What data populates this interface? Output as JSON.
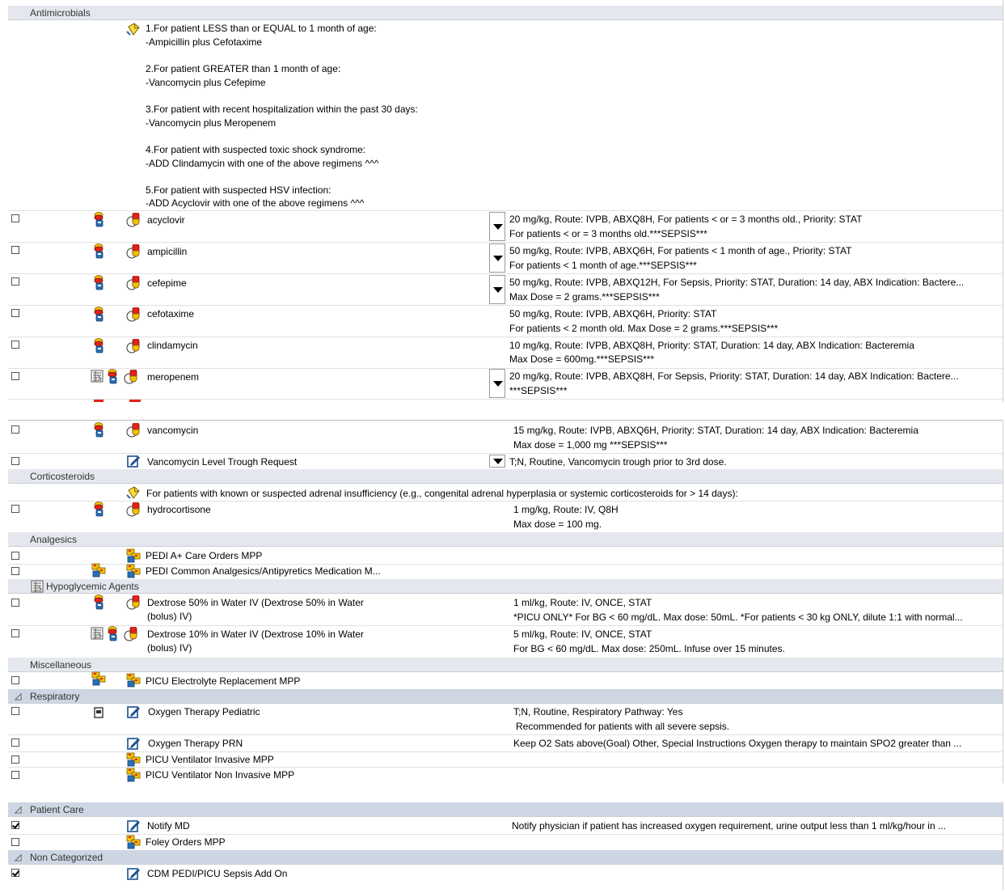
{
  "sections": {
    "antimicrobials": "Antimicrobials",
    "corticosteroids": "Corticosteroids",
    "analgesics": "Analgesics",
    "hypoglycemic": "Hypoglycemic Agents",
    "miscellaneous": "Miscellaneous",
    "respiratory": "Respiratory",
    "patient_care": "Patient Care",
    "non_categorized": "Non Categorized"
  },
  "antimicrobial_note": [
    "1.For patient LESS than or EQUAL to 1 month of age:",
    "-Ampicillin plus Cefotaxime",
    "2.For patient GREATER than 1 month of age:",
    "-Vancomycin plus Cefepime",
    "3.For patient with recent hospitalization within the past 30 days:",
    "-Vancomycin plus Meropenem",
    "4.For patient with suspected toxic shock syndrome:",
    "-ADD Clindamycin with one of the above regimens ^^^",
    "5.For patient with suspected HSV infection:",
    "-ADD Acyclovir with one of the above regimens ^^^"
  ],
  "meds": [
    {
      "name": "acyclovir",
      "d1": "20 mg/kg, Route: IVPB, ABXQ8H, For patients < or = 3 months old., Priority: STAT",
      "d2": "For patients <  or = 3 months old.***SEPSIS***"
    },
    {
      "name": "ampicillin",
      "d1": "50 mg/kg, Route: IVPB, ABXQ6H, For patients < 1 month of age., Priority: STAT",
      "d2": "For patients < 1 month of age.***SEPSIS***"
    },
    {
      "name": "cefepime",
      "d1": "50 mg/kg, Route: IVPB, ABXQ12H, For Sepsis, Priority: STAT, Duration: 14 day, ABX Indication: Bactere...",
      "d2": "Max Dose = 2 grams.***SEPSIS***"
    },
    {
      "name": "cefotaxime",
      "d1": "50 mg/kg, Route: IVPB, ABXQ6H, Priority: STAT",
      "d2": "For patients < 2 month old.  Max Dose = 2 grams.***SEPSIS***"
    },
    {
      "name": "clindamycin",
      "d1": "10 mg/kg, Route: IVPB, ABXQ8H, Priority: STAT, Duration: 14 day, ABX Indication: Bacteremia",
      "d2": "Max Dose = 600mg.***SEPSIS***"
    },
    {
      "name": "meropenem",
      "d1": "20 mg/kg, Route: IVPB, ABXQ8H, For Sepsis, Priority: STAT, Duration: 14 day, ABX Indication: Bactere...",
      "d2": "***SEPSIS***"
    },
    {
      "name": "vancomycin",
      "d1": "15 mg/kg, Route: IVPB, ABXQ6H, Priority: STAT, Duration: 14 day, ABX Indication: Bacteremia",
      "d2": "Max dose = 1,000 mg ***SEPSIS***"
    }
  ],
  "vanc_trough": {
    "name": "Vancomycin Level Trough Request",
    "d1": "T;N, Routine, Vancomycin trough prior to 3rd dose."
  },
  "cortico_note": "For patients with known or suspected adrenal insufficiency (e.g., congenital adrenal hyperplasia or systemic corticosteroids for > 14 days):",
  "hydrocortisone": {
    "name": "hydrocortisone",
    "d1": "1 mg/kg, Route: IV, Q8H",
    "d2": "Max dose = 100 mg."
  },
  "analgesics": [
    "PEDI A+ Care Orders MPP",
    "PEDI Common Analgesics/Antipyretics Medication  M..."
  ],
  "dextrose50": {
    "n1": "Dextrose 50% in Water IV (Dextrose 50% in Water",
    "n2": "(bolus) IV)",
    "d1": "1 ml/kg, Route: IV, ONCE, STAT",
    "d2": "*PICU ONLY* For BG < 60 mg/dL. Max dose: 50mL. *For patients < 30 kg ONLY, dilute 1:1 with normal..."
  },
  "dextrose10": {
    "n1": "Dextrose 10% in Water IV (Dextrose 10% in Water",
    "n2": "(bolus) IV)",
    "d1": "5 ml/kg, Route: IV, ONCE, STAT",
    "d2": "For BG < 60 mg/dL. Max dose: 250mL. Infuse over 15 minutes."
  },
  "misc": [
    "PICU Electrolyte Replacement MPP"
  ],
  "oxy_ped": {
    "name": "Oxygen Therapy Pediatric",
    "d1": "T;N, Routine, Respiratory Pathway: Yes",
    "d2": "Recommended for patients with all severe sepsis."
  },
  "oxy_prn": {
    "name": "Oxygen Therapy PRN",
    "d1": "Keep O2 Sats above(Goal) Other, Special Instructions Oxygen therapy to maintain SPO2 greater than ..."
  },
  "vent": [
    "PICU Ventilator Invasive MPP",
    "PICU Ventilator Non Invasive MPP"
  ],
  "notify": {
    "name": "Notify MD",
    "d1": "Notify physician if patient has increased oxygen requirement, urine output less than 1 ml/kg/hour in ..."
  },
  "foley": "Foley Orders MPP",
  "cdm": "CDM PEDI/PICU Sepsis Add On",
  "colors": {
    "header": "#e4e8ee",
    "header_dark": "#cdd6e2",
    "pill_red": "#e32219",
    "pill_yellow": "#f2c200",
    "pill_blue": "#2a6fb5"
  }
}
